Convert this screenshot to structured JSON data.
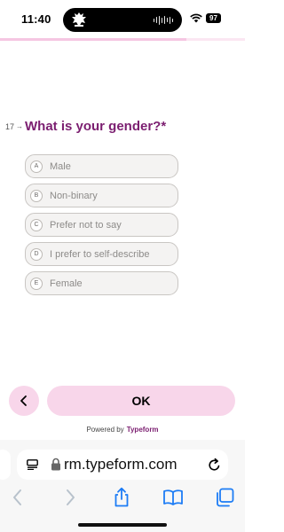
{
  "status_bar": {
    "time": "11:40",
    "battery": "97",
    "island_logo_icon": "team-crest-icon",
    "island_activity_icon": "audio-waveform-icon",
    "wifi_icon": "wifi-icon"
  },
  "form": {
    "progress_fraction": 0.76,
    "question": {
      "number": "17",
      "arrow": "→",
      "title": "What is your gender?*"
    },
    "options": [
      {
        "key": "A",
        "label": "Male"
      },
      {
        "key": "B",
        "label": "Non-binary"
      },
      {
        "key": "C",
        "label": "Prefer not to say"
      },
      {
        "key": "D",
        "label": "I prefer to self-describe"
      },
      {
        "key": "E",
        "label": "Female"
      }
    ],
    "ok_label": "OK",
    "powered_by": "Powered by",
    "brand": "Typeform"
  },
  "browser": {
    "address": "rm.typeform.com"
  },
  "colors": {
    "accent": "#7b1e70",
    "button_bg": "#f8d6ea",
    "ios_blue": "#1c7cf5"
  }
}
